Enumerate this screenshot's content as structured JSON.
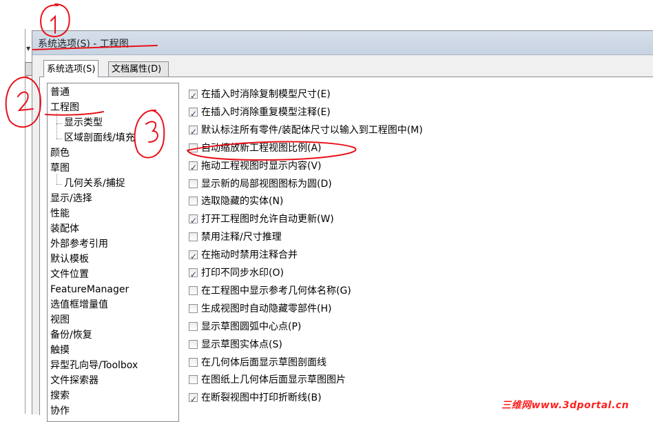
{
  "dialog": {
    "title": "系统选项(S) - 工程图",
    "tabs": [
      {
        "label": "系统选项(S)",
        "active": true
      },
      {
        "label": "文档属性(D)",
        "active": false
      }
    ]
  },
  "tree": {
    "items": [
      {
        "label": "普通",
        "level": 0,
        "selected": false
      },
      {
        "label": "工程图",
        "level": 0,
        "selected": true
      },
      {
        "label": "显示类型",
        "level": 1,
        "selected": false
      },
      {
        "label": "区域剖面线/填充",
        "level": 1,
        "selected": false
      },
      {
        "label": "颜色",
        "level": 0,
        "selected": false
      },
      {
        "label": "草图",
        "level": 0,
        "selected": false
      },
      {
        "label": "几何关系/捕捉",
        "level": 1,
        "selected": false
      },
      {
        "label": "显示/选择",
        "level": 0,
        "selected": false
      },
      {
        "label": "性能",
        "level": 0,
        "selected": false
      },
      {
        "label": "装配体",
        "level": 0,
        "selected": false
      },
      {
        "label": "外部参考引用",
        "level": 0,
        "selected": false
      },
      {
        "label": "默认模板",
        "level": 0,
        "selected": false
      },
      {
        "label": "文件位置",
        "level": 0,
        "selected": false
      },
      {
        "label": "FeatureManager",
        "level": 0,
        "selected": false
      },
      {
        "label": "选值框增量值",
        "level": 0,
        "selected": false
      },
      {
        "label": "视图",
        "level": 0,
        "selected": false
      },
      {
        "label": "备份/恢复",
        "level": 0,
        "selected": false
      },
      {
        "label": "触摸",
        "level": 0,
        "selected": false
      },
      {
        "label": "异型孔向导/Toolbox",
        "level": 0,
        "selected": false
      },
      {
        "label": "文件探索器",
        "level": 0,
        "selected": false
      },
      {
        "label": "搜索",
        "level": 0,
        "selected": false
      },
      {
        "label": "协作",
        "level": 0,
        "selected": false
      }
    ]
  },
  "options": [
    {
      "label": "在插入时消除复制模型尺寸(E)",
      "checked": true
    },
    {
      "label": "在插入时消除重复模型注释(E)",
      "checked": true
    },
    {
      "label": "默认标注所有零件/装配体尺寸以输入到工程图中(M)",
      "checked": true
    },
    {
      "label": "自动缩放新工程视图比例(A)",
      "checked": false
    },
    {
      "label": "拖动工程视图时显示内容(V)",
      "checked": true
    },
    {
      "label": "显示新的局部视图图标为圆(D)",
      "checked": false
    },
    {
      "label": "选取隐藏的实体(N)",
      "checked": false
    },
    {
      "label": "打开工程图时允许自动更新(W)",
      "checked": true
    },
    {
      "label": "禁用注释/尺寸推理",
      "checked": false
    },
    {
      "label": "在拖动时禁用注释合并",
      "checked": true
    },
    {
      "label": "打印不同步水印(O)",
      "checked": true
    },
    {
      "label": "在工程图中显示参考几何体名称(G)",
      "checked": false
    },
    {
      "label": "生成视图时自动隐藏零部件(H)",
      "checked": false
    },
    {
      "label": "显示草图圆弧中心点(P)",
      "checked": false
    },
    {
      "label": "显示草图实体点(S)",
      "checked": false
    },
    {
      "label": "在几何体后面显示草图剖面线",
      "checked": false
    },
    {
      "label": "在图纸上几何体后面显示草图图片",
      "checked": false
    },
    {
      "label": "在断裂视图中打印折断线(B)",
      "checked": true
    }
  ],
  "annotations": {
    "marks": [
      "1",
      "2",
      "3"
    ],
    "color": "#e8101a"
  },
  "watermark": "三维网www.3dportal.cn"
}
